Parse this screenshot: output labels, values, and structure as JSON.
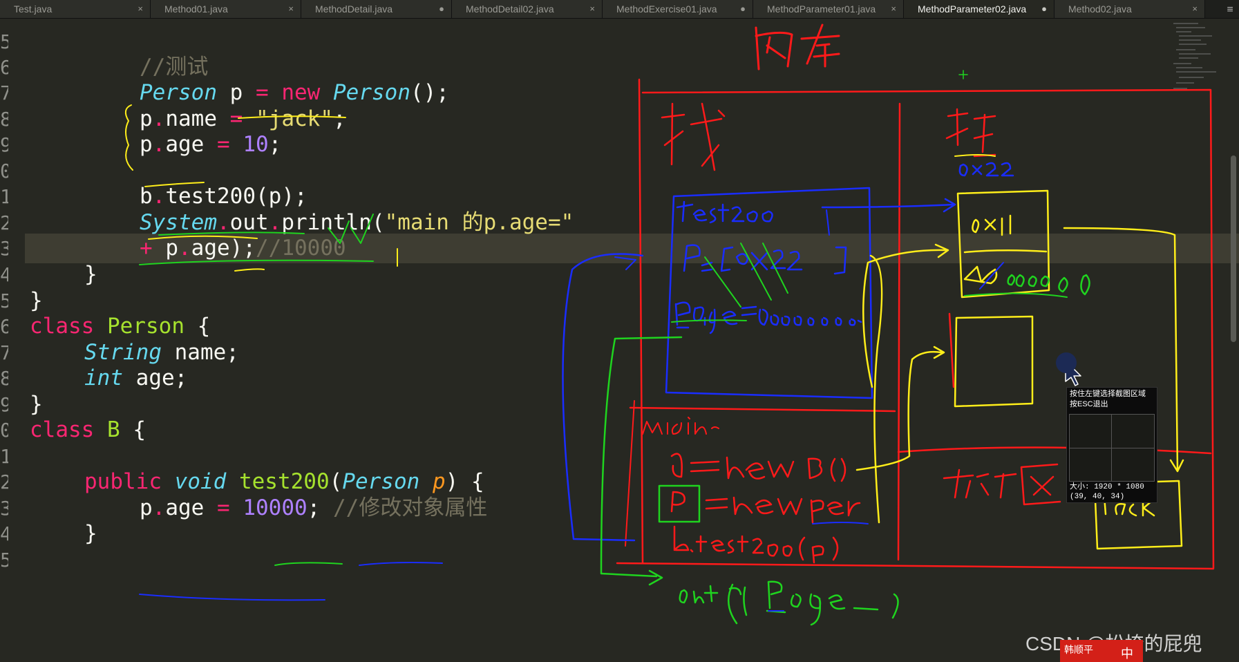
{
  "tabs": [
    {
      "label": "Test.java",
      "control": "×"
    },
    {
      "label": "Method01.java",
      "control": "×"
    },
    {
      "label": "MethodDetail.java",
      "control": "●"
    },
    {
      "label": "MethodDetail02.java",
      "control": "×"
    },
    {
      "label": "MethodExercise01.java",
      "control": "●"
    },
    {
      "label": "MethodParameter01.java",
      "control": "×"
    },
    {
      "label": "MethodParameter02.java",
      "control": "●"
    },
    {
      "label": "Method02.java",
      "control": "×"
    }
  ],
  "tab_menu": "≡",
  "line_numbers": [
    "5",
    "6",
    "7",
    "8",
    "9",
    "0",
    "1",
    "2",
    "3",
    "4",
    "5",
    "6",
    "7",
    "8",
    "9",
    "0",
    "1",
    "2",
    "3",
    "4",
    "5"
  ],
  "code": {
    "l6_comment": "//测试",
    "l7": {
      "t1": "Person",
      "t2": " p ",
      "t3": "=",
      "t4": " ",
      "t5": "new",
      "t6": " ",
      "t7": "Person",
      "t8": "();"
    },
    "l8": {
      "t1": "p",
      "t2": ".",
      "t3": "name ",
      "t4": "=",
      "t5": " ",
      "t6": "\"jack\"",
      "t7": ";"
    },
    "l9": {
      "t1": "p",
      "t2": ".",
      "t3": "age ",
      "t4": "=",
      "t5": " ",
      "t6": "10",
      "t7": ";"
    },
    "l11": {
      "t1": "b",
      "t2": ".",
      "t3": "test200(p);"
    },
    "l12": {
      "t1": "System",
      "t2": ".",
      "t3": "out",
      "t4": ".",
      "t5": "println(",
      "t6": "\"main 的p.age=\""
    },
    "l13": {
      "t1": "+",
      "t2": " p",
      "t3": ".",
      "t4": "age);",
      "t5": "//10000"
    },
    "l14": "}",
    "l15": "}",
    "l16": {
      "t1": "class",
      "t2": " ",
      "t3": "Person",
      "t4": " {"
    },
    "l17": {
      "t1": "String",
      "t2": " name;"
    },
    "l18": {
      "t1": "int",
      "t2": " age;"
    },
    "l19": "}",
    "l20": {
      "t1": "class",
      "t2": " ",
      "t3": "B",
      "t4": " {"
    },
    "l22": {
      "t1": "public",
      "t2": " ",
      "t3": "void",
      "t4": " ",
      "t5": "test200",
      "t6": "(",
      "t7": "Person",
      "t8": " ",
      "t9": "p",
      "t10": ") {"
    },
    "l23": {
      "t1": "p",
      "t2": ".",
      "t3": "age ",
      "t4": "=",
      "t5": " ",
      "t6": "10000",
      "t7": "; ",
      "t8": "//修改对象属性"
    },
    "l24": "}"
  },
  "annotations": {
    "memory": "内存",
    "stack": "栈",
    "heap": "堆",
    "heap_addr": "0x22",
    "test200_frame": "test200",
    "p_ref": "P=[0x22]",
    "p_age": "p.age=10000",
    "obj_field1": "0x11",
    "obj_field2": "10/10000",
    "main_frame": "main",
    "b_line": "b=new B()",
    "p_line": "p=new per",
    "call_line": "b.test200(p)",
    "out_line": "out(p.age)",
    "method_area": "方法区",
    "jack": "jack"
  },
  "snip_tool": {
    "tip_line1": "按住左键选择截图区域",
    "tip_line2": "按ESC退出",
    "size_label": "大小: 1920 * 1080",
    "color_value": "(39, 40, 34)"
  },
  "watermark": "CSDN @松垮的屁兜",
  "logo_text": "韩顺平",
  "logo_zh": "中",
  "colors": {
    "editor_bg": "#272822",
    "keyword": "#f92672",
    "type": "#66d9ef",
    "string": "#e6db74",
    "number": "#ae81ff",
    "comment": "#75715e",
    "function": "#a6e22e",
    "pen_red": "#ff1a1a",
    "pen_blue": "#1a2dff",
    "pen_yellow": "#ffee1a",
    "pen_green": "#1fd41f"
  }
}
